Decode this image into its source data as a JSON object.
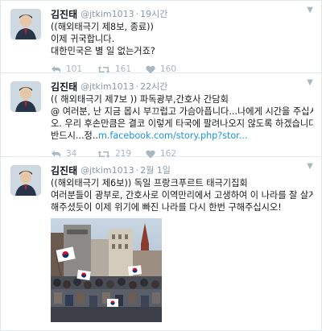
{
  "tweets": [
    {
      "name": "김진태",
      "handle": "@jtkim1013",
      "time": "19시간",
      "lines": [
        "((해외태극기 제8보, 종료))",
        "이제 귀국합니다.",
        "대한민국은 별 일 없는거죠?"
      ],
      "replies": "101",
      "retweets": "161",
      "likes": "160"
    },
    {
      "name": "김진태",
      "handle": "@jtkim1013",
      "time": "22시간",
      "lines": [
        "(( 해외태극기 제7보 )) 파독광부,간호사 간담회",
        "@ 여러분, 난 지금 몹시 부끄럽고 가슴아픕니다...나에게 시간을 주십시",
        "오. 우리 후손만큼은 결코 이렇게 타국에 팔려나오지 않도록 하겠습니다."
      ],
      "last_line_prefix": "반드시...정..",
      "link": "m.facebook.com/story.php?stor...",
      "replies": "34",
      "retweets": "219",
      "likes": "162"
    },
    {
      "name": "김진태",
      "handle": "@jtkim1013",
      "time": "2월 1일",
      "lines": [
        "((해외태극기 제6보)) 독일 프랑크푸르트 태극기집회",
        "여러분들이 광부로, 간호사로 이역만리에서 고생하여 이 나라를 잘 살게",
        "해주셨듯이 이제 위기에 빠진 나라를 다시 한번 구해주십시오!"
      ]
    }
  ],
  "colors": {
    "name": "#14171a",
    "meta": "#8899a6",
    "icon": "#aab8c2",
    "link": "#1b95e0",
    "divider": "#e6ecf0"
  },
  "icons": {
    "caret": "chevron-down-icon",
    "reply": "reply-icon",
    "retweet": "retweet-icon",
    "like": "heart-icon"
  }
}
